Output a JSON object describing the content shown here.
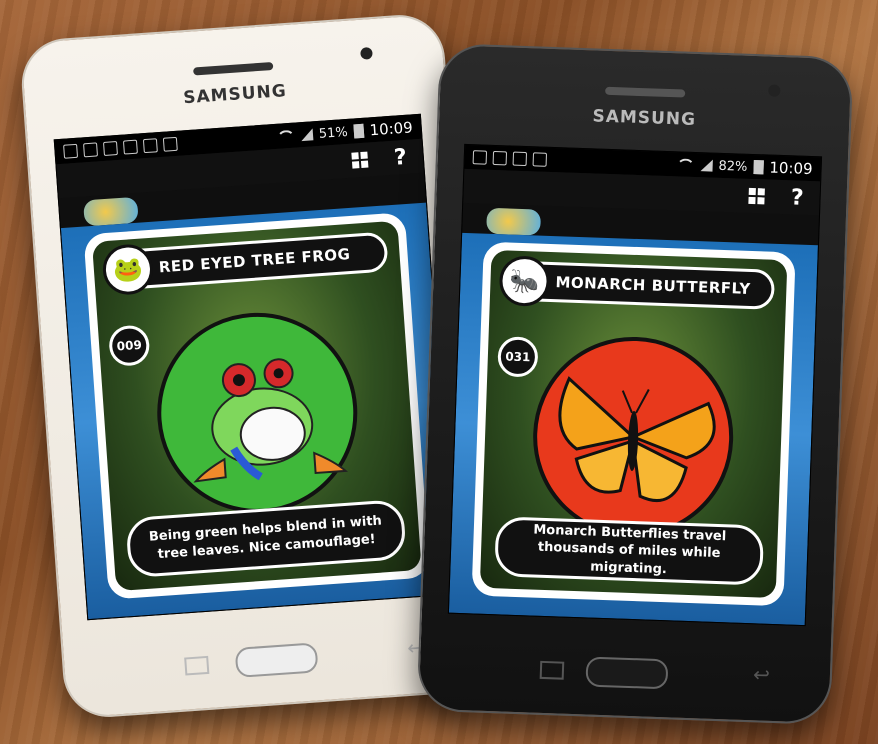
{
  "phones": [
    {
      "brand": "SAMSUNG",
      "status": {
        "battery": "51%",
        "time": "10:09"
      },
      "card": {
        "title": "RED EYED TREE FROG",
        "number": "009",
        "icon": "frog-icon",
        "circle_color": "#3fb83a",
        "fact": "Being green helps blend in with tree leaves. Nice camouflage!"
      }
    },
    {
      "brand": "SAMSUNG",
      "status": {
        "battery": "82%",
        "time": "10:09"
      },
      "card": {
        "title": "MONARCH BUTTERFLY",
        "number": "031",
        "icon": "ant-icon",
        "circle_color": "#e8391c",
        "fact": "Monarch Butterflies travel thousands of miles while migrating."
      }
    }
  ]
}
